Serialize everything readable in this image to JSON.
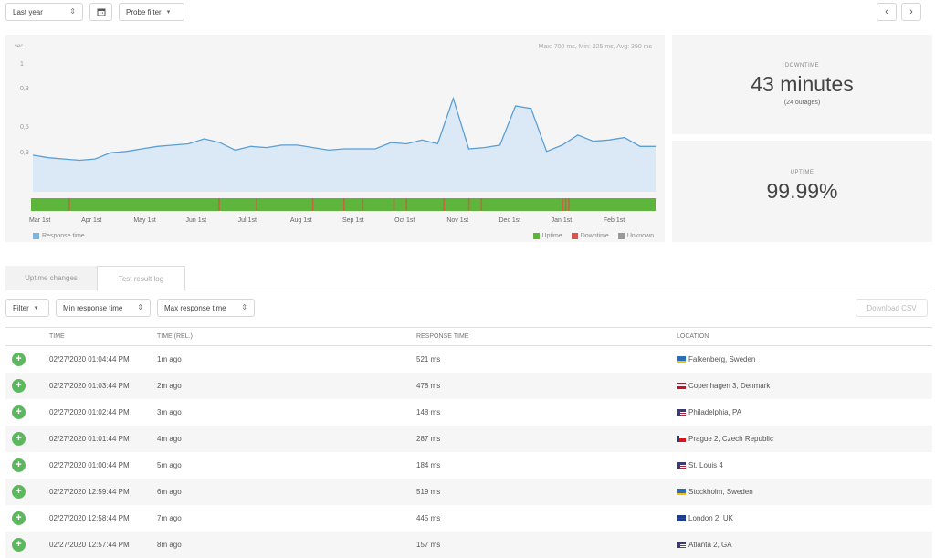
{
  "toolbar": {
    "period": "Last year",
    "probe_filter": "Probe filter",
    "colors": {
      "border": "#d6d6d6"
    }
  },
  "chart": {
    "stats_text": "Max: 700 ms, Min: 225 ms, Avg: 390 ms",
    "unit": "sec",
    "yticks": [
      "1",
      "0,8",
      "0,5",
      "0,3"
    ],
    "months": [
      "Mar 1st",
      "Apr 1st",
      "May 1st",
      "Jun 1st",
      "Jul 1st",
      "Aug 1st",
      "Sep 1st",
      "Oct 1st",
      "Nov 1st",
      "Dec 1st",
      "Jan 1st",
      "Feb 1st"
    ],
    "legend_left": "Response time",
    "legend_right": [
      {
        "label": "Uptime",
        "color": "#5db63b"
      },
      {
        "label": "Downtime",
        "color": "#d9534f"
      },
      {
        "label": "Unknown",
        "color": "#999999"
      }
    ]
  },
  "chart_data": {
    "type": "area",
    "title": "",
    "ylabel": "sec",
    "ylim": [
      0,
      1.1
    ],
    "x": [
      "Mar 1st",
      "",
      "",
      "",
      "",
      "Apr 1st",
      "",
      "",
      "May 1st",
      "",
      "",
      "Jun 1st",
      "",
      "",
      "Jul 1st",
      "",
      "",
      "Aug 1st",
      "",
      "",
      "Sep 1st",
      "",
      "",
      "Oct 1st",
      "",
      "",
      "",
      "Nov 1st",
      "",
      "",
      "",
      "Dec 1st",
      "",
      "",
      "Jan 1st",
      "",
      "",
      "",
      "Feb 1st",
      "",
      ""
    ],
    "series": [
      {
        "name": "Response time",
        "values": [
          0.29,
          0.27,
          0.26,
          0.25,
          0.26,
          0.31,
          0.32,
          0.34,
          0.36,
          0.37,
          0.38,
          0.42,
          0.39,
          0.33,
          0.36,
          0.35,
          0.37,
          0.37,
          0.35,
          0.33,
          0.34,
          0.34,
          0.34,
          0.39,
          0.38,
          0.41,
          0.38,
          0.74,
          0.34,
          0.35,
          0.37,
          0.68,
          0.66,
          0.32,
          0.37,
          0.45,
          0.4,
          0.41,
          0.43,
          0.36,
          0.36
        ],
        "color": "#5a9fd6",
        "fill": "#dbe9f6"
      }
    ],
    "status_bar": {
      "uptime_color": "#5db63b",
      "downtime_color": "#d9534f"
    }
  },
  "downtime": {
    "label": "DOWNTIME",
    "value": "43 minutes",
    "sub": "(24 outages)"
  },
  "uptime": {
    "label": "UPTIME",
    "value": "99.99%"
  },
  "tabs": [
    {
      "label": "Uptime changes",
      "active": false
    },
    {
      "label": "Test result log",
      "active": true
    }
  ],
  "filters": {
    "filter_label": "Filter",
    "min_rt_label": "Min response time",
    "max_rt_label": "Max response time",
    "download_label": "Download CSV"
  },
  "table": {
    "headers": [
      "TIME",
      "TIME (REL.)",
      "RESPONSE TIME",
      "LOCATION"
    ],
    "rows": [
      {
        "time": "02/27/2020 01:04:44 PM",
        "rel": "1m ago",
        "rt": "521 ms",
        "flag": "se",
        "location": "Falkenberg, Sweden"
      },
      {
        "time": "02/27/2020 01:03:44 PM",
        "rel": "2m ago",
        "rt": "478 ms",
        "flag": "dk",
        "location": "Copenhagen 3, Denmark"
      },
      {
        "time": "02/27/2020 01:02:44 PM",
        "rel": "3m ago",
        "rt": "148 ms",
        "flag": "us",
        "location": "Philadelphia, PA"
      },
      {
        "time": "02/27/2020 01:01:44 PM",
        "rel": "4m ago",
        "rt": "287 ms",
        "flag": "cz",
        "location": "Prague 2, Czech Republic"
      },
      {
        "time": "02/27/2020 01:00:44 PM",
        "rel": "5m ago",
        "rt": "184 ms",
        "flag": "us",
        "location": "St. Louis 4"
      },
      {
        "time": "02/27/2020 12:59:44 PM",
        "rel": "6m ago",
        "rt": "519 ms",
        "flag": "se",
        "location": "Stockholm, Sweden"
      },
      {
        "time": "02/27/2020 12:58:44 PM",
        "rel": "7m ago",
        "rt": "445 ms",
        "flag": "uk",
        "location": "London 2, UK"
      },
      {
        "time": "02/27/2020 12:57:44 PM",
        "rel": "8m ago",
        "rt": "157 ms",
        "flag": "us",
        "location": "Atlanta 2, GA"
      }
    ]
  }
}
